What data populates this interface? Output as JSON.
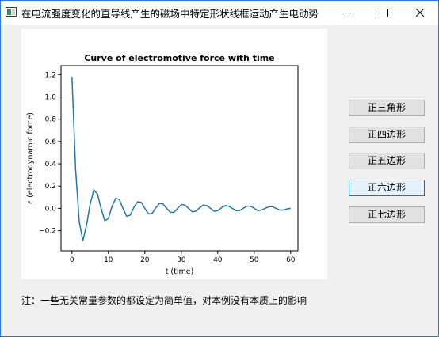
{
  "window": {
    "title": "在电流强度变化的直导线产生的磁场中特定形状线框运动产生电动势"
  },
  "buttons": [
    {
      "label": "正三角形"
    },
    {
      "label": "正四边形"
    },
    {
      "label": "正五边形"
    },
    {
      "label": "正六边形"
    },
    {
      "label": "正七边形"
    }
  ],
  "selected_button": "正六边形",
  "note": "注：一些无关常量参数的都设定为简单值，对本例没有本质上的影响",
  "colors": {
    "line": "#1f77b4",
    "accent_border": "#0078d7"
  },
  "chart_data": {
    "type": "line",
    "title": "Curve of electromotive force with time",
    "xlabel": "t (time)",
    "ylabel": "ε (electrodynamic force)",
    "xlim": [
      -3,
      62
    ],
    "ylim": [
      -0.38,
      1.28
    ],
    "xticks": [
      0,
      10,
      20,
      30,
      40,
      50,
      60
    ],
    "yticks": [
      -0.2,
      0.0,
      0.2,
      0.4,
      0.6,
      0.8,
      1.0,
      1.2
    ],
    "ytick_labels": [
      "−0.2",
      "0.0",
      "0.2",
      "0.4",
      "0.6",
      "0.8",
      "1.0",
      "1.2"
    ],
    "grid": false,
    "series": [
      {
        "x": [
          0,
          1,
          2,
          3,
          4,
          5,
          6,
          7,
          8,
          9,
          10,
          11,
          12,
          13,
          14,
          15,
          16,
          17,
          18,
          19,
          20,
          21,
          22,
          23,
          24,
          25,
          26,
          27,
          28,
          29,
          30,
          31,
          32,
          33,
          34,
          35,
          36,
          37,
          38,
          39,
          40,
          41,
          42,
          43,
          44,
          45,
          46,
          47,
          48,
          49,
          50,
          51,
          52,
          53,
          54,
          55,
          56,
          57,
          58,
          59,
          60
        ],
        "y": [
          1.18,
          0.35,
          -0.12,
          -0.29,
          -0.15,
          0.04,
          0.165,
          0.13,
          0.0,
          -0.11,
          -0.09,
          0.02,
          0.09,
          0.08,
          0.0,
          -0.07,
          -0.06,
          0.01,
          0.06,
          0.055,
          0.0,
          -0.05,
          -0.045,
          0.005,
          0.045,
          0.04,
          0.0,
          -0.035,
          -0.035,
          0.0,
          0.035,
          0.03,
          0.0,
          -0.03,
          -0.025,
          0.005,
          0.03,
          0.025,
          0.0,
          -0.025,
          -0.02,
          0.005,
          0.025,
          0.02,
          0.0,
          -0.02,
          -0.02,
          0.0,
          0.02,
          0.02,
          0.0,
          -0.02,
          -0.015,
          0.0,
          0.015,
          0.015,
          0.0,
          -0.015,
          -0.015,
          -0.005,
          0.0
        ]
      }
    ]
  }
}
